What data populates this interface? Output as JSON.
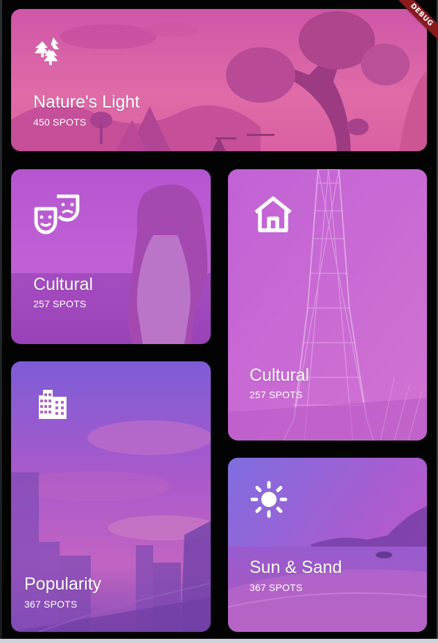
{
  "debug_banner": "DEBUG",
  "cards": [
    {
      "id": "natures-light",
      "title": "Nature's Light",
      "spots": "450 SPOTS",
      "icon": "forest-icon"
    },
    {
      "id": "cultural-1",
      "title": "Cultural",
      "spots": "257 SPOTS",
      "icon": "theater-masks-icon"
    },
    {
      "id": "cultural-2",
      "title": "Cultural",
      "spots": "257 SPOTS",
      "icon": "home-icon"
    },
    {
      "id": "popularity",
      "title": "Popularity",
      "spots": "367 SPOTS",
      "icon": "city-buildings-icon"
    },
    {
      "id": "sun-sand",
      "title": "Sun & Sand",
      "spots": "367 SPOTS",
      "icon": "sun-icon"
    }
  ],
  "colors": {
    "background": "#030303",
    "tint_pink": "#e05bb8",
    "tint_purple": "#b052d0",
    "tint_blue": "#7f6ae0",
    "text": "#ffffff"
  }
}
